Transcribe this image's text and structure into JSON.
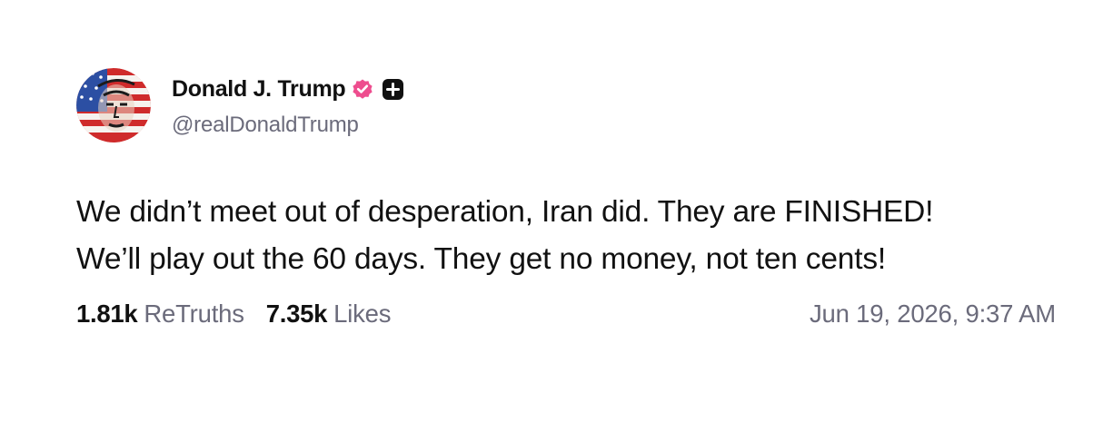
{
  "post": {
    "author": {
      "display_name": "Donald J. Trump",
      "handle": "@realDonaldTrump",
      "verified_icon": "verified-badge-icon",
      "badge_icon": "plus-badge-icon",
      "accent_color": "#ee4d8e"
    },
    "text_lines": [
      "We didn’t meet out of desperation, Iran did. They are FINISHED!",
      "We’ll play out the 60 days. They get no money, not ten cents!"
    ],
    "stats": {
      "retruths_count": "1.81k",
      "retruths_label": "ReTruths",
      "likes_count": "7.35k",
      "likes_label": "Likes"
    },
    "timestamp": "Jun 19, 2026, 9:37 AM"
  }
}
